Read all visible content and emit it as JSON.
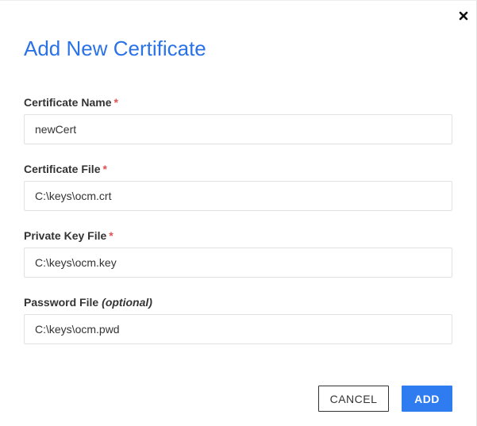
{
  "dialog": {
    "title": "Add New Certificate",
    "close_icon": "close-icon"
  },
  "fields": {
    "certificate_name": {
      "label": "Certificate Name",
      "required_mark": "*",
      "value": "newCert"
    },
    "certificate_file": {
      "label": "Certificate File",
      "required_mark": "*",
      "value": "C:\\keys\\ocm.crt"
    },
    "private_key_file": {
      "label": "Private Key File",
      "required_mark": "*",
      "value": "C:\\keys\\ocm.key"
    },
    "password_file": {
      "label": "Password File",
      "optional_note": "(optional)",
      "value": "C:\\keys\\ocm.pwd"
    }
  },
  "buttons": {
    "cancel_label": "CANCEL",
    "add_label": "ADD"
  },
  "colors": {
    "title": "#2b72e6",
    "required": "#e05252",
    "primary": "#2f7bf0"
  }
}
